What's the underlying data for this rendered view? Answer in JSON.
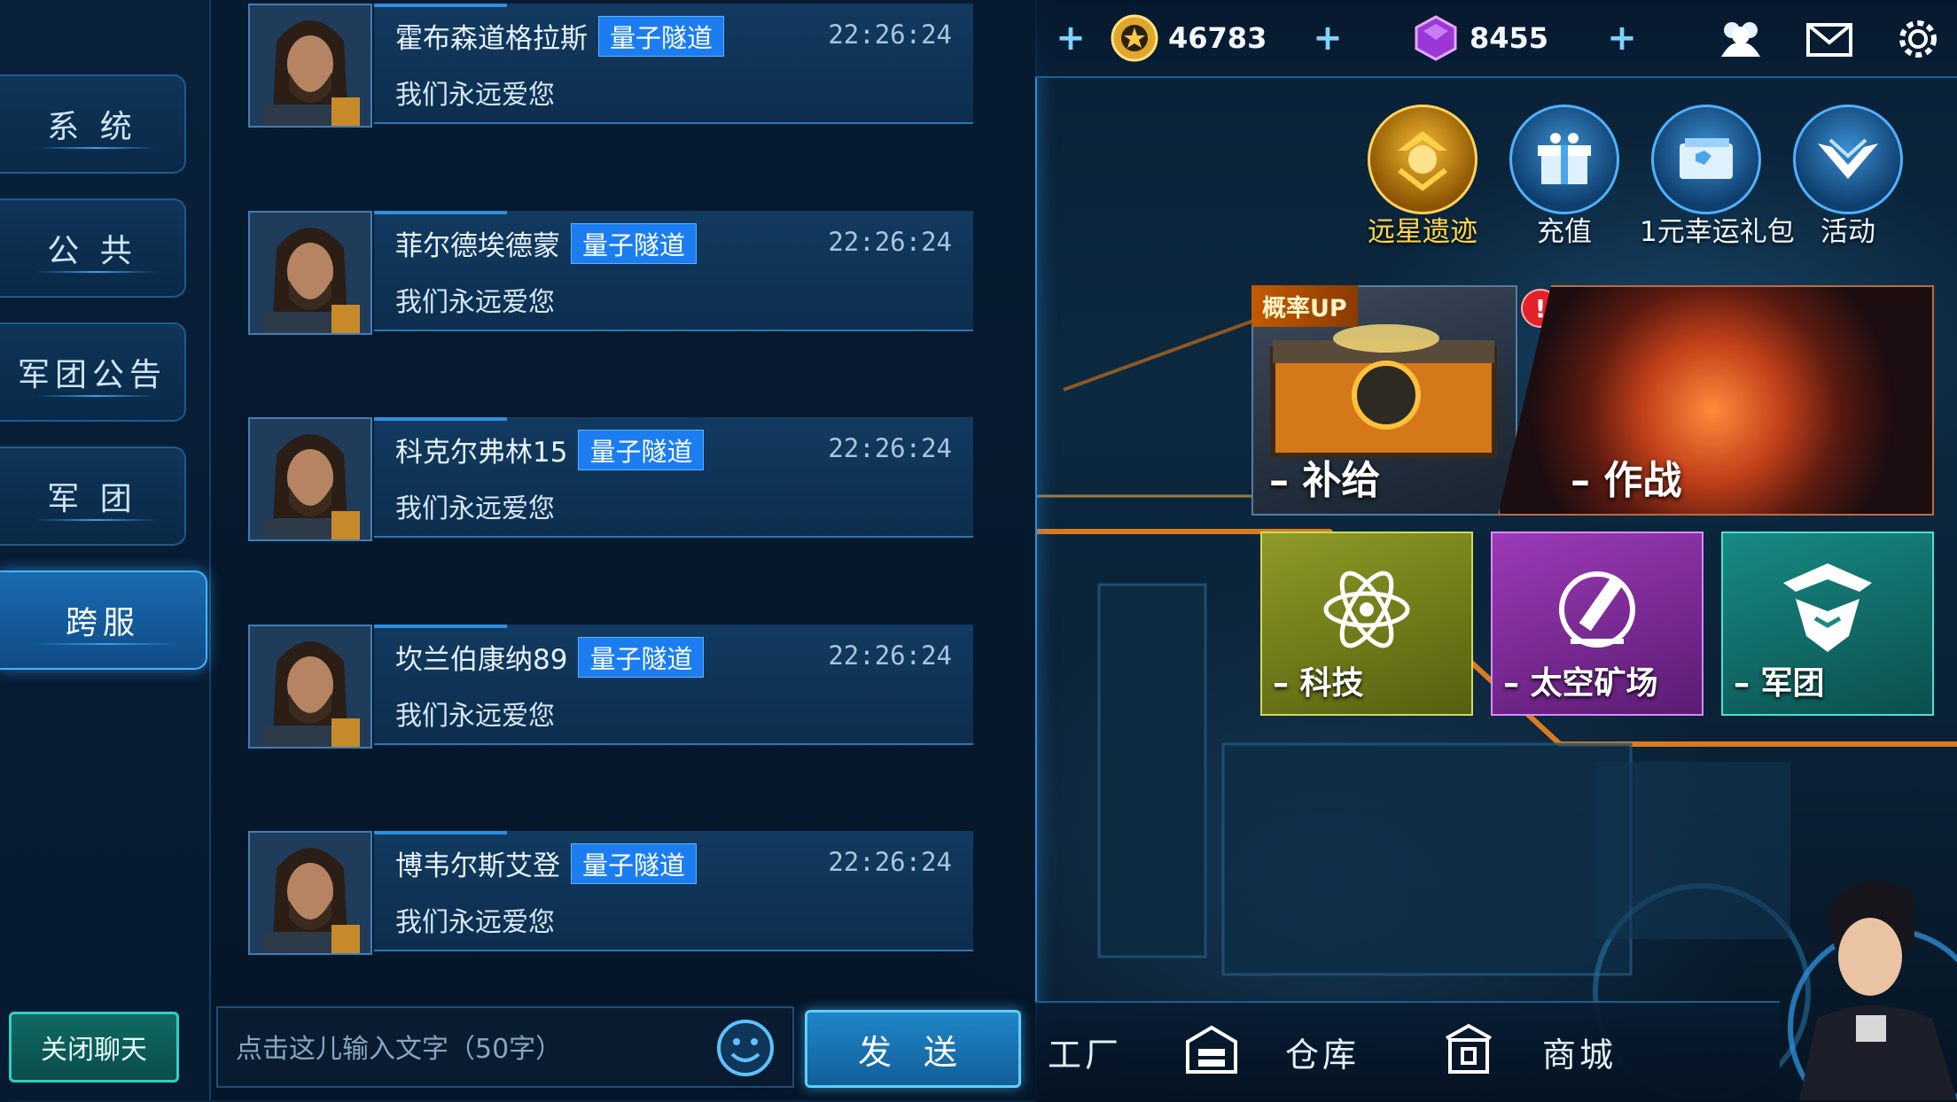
{
  "sidebar": {
    "tabs": [
      {
        "label": "系 统"
      },
      {
        "label": "公 共"
      },
      {
        "label": "军团公告"
      },
      {
        "label": "军 团"
      },
      {
        "label": "跨服"
      }
    ],
    "active_index": 4,
    "close_button": "关闭聊天"
  },
  "messages": [
    {
      "name": "霍布森道格拉斯",
      "badge": "量子隧道",
      "time": "22:26:24",
      "text": "我们永远爱您"
    },
    {
      "name": "菲尔德埃德蒙",
      "badge": "量子隧道",
      "time": "22:26:24",
      "text": "我们永远爱您"
    },
    {
      "name": "科克尔弗林15",
      "badge": "量子隧道",
      "time": "22:26:24",
      "text": "我们永远爱您"
    },
    {
      "name": "坎兰伯康纳89",
      "badge": "量子隧道",
      "time": "22:26:24",
      "text": "我们永远爱您"
    },
    {
      "name": "博韦尔斯艾登",
      "badge": "量子隧道",
      "time": "22:26:24",
      "text": "我们永远爱您"
    }
  ],
  "input": {
    "placeholder": "点击这儿输入文字（50字）",
    "value": "",
    "send_label": "发 送"
  },
  "resources": {
    "gold": "46783",
    "crystal": "8455",
    "plus": "+"
  },
  "features": [
    {
      "label": "远星遗迹",
      "icon": "relic-icon"
    },
    {
      "label": "充值",
      "icon": "gift-icon"
    },
    {
      "label": "1元幸运礼包",
      "icon": "card-pack-icon"
    },
    {
      "label": "活动",
      "icon": "wings-icon"
    }
  ],
  "banners": {
    "prob_tag": "概率UP",
    "alert": "!",
    "supply": "– 补给",
    "battle": "– 作战"
  },
  "tiles": {
    "tech": "– 科技",
    "mine": "– 太空矿场",
    "legion": "– 军团"
  },
  "bottom_nav": {
    "factory": "工厂",
    "warehouse": "仓库",
    "shop": "商城"
  },
  "colors": {
    "accent": "#2a8fd6",
    "badge": "#1b7df0",
    "gold_label": "#ffd84a",
    "alert": "#e4202a"
  }
}
